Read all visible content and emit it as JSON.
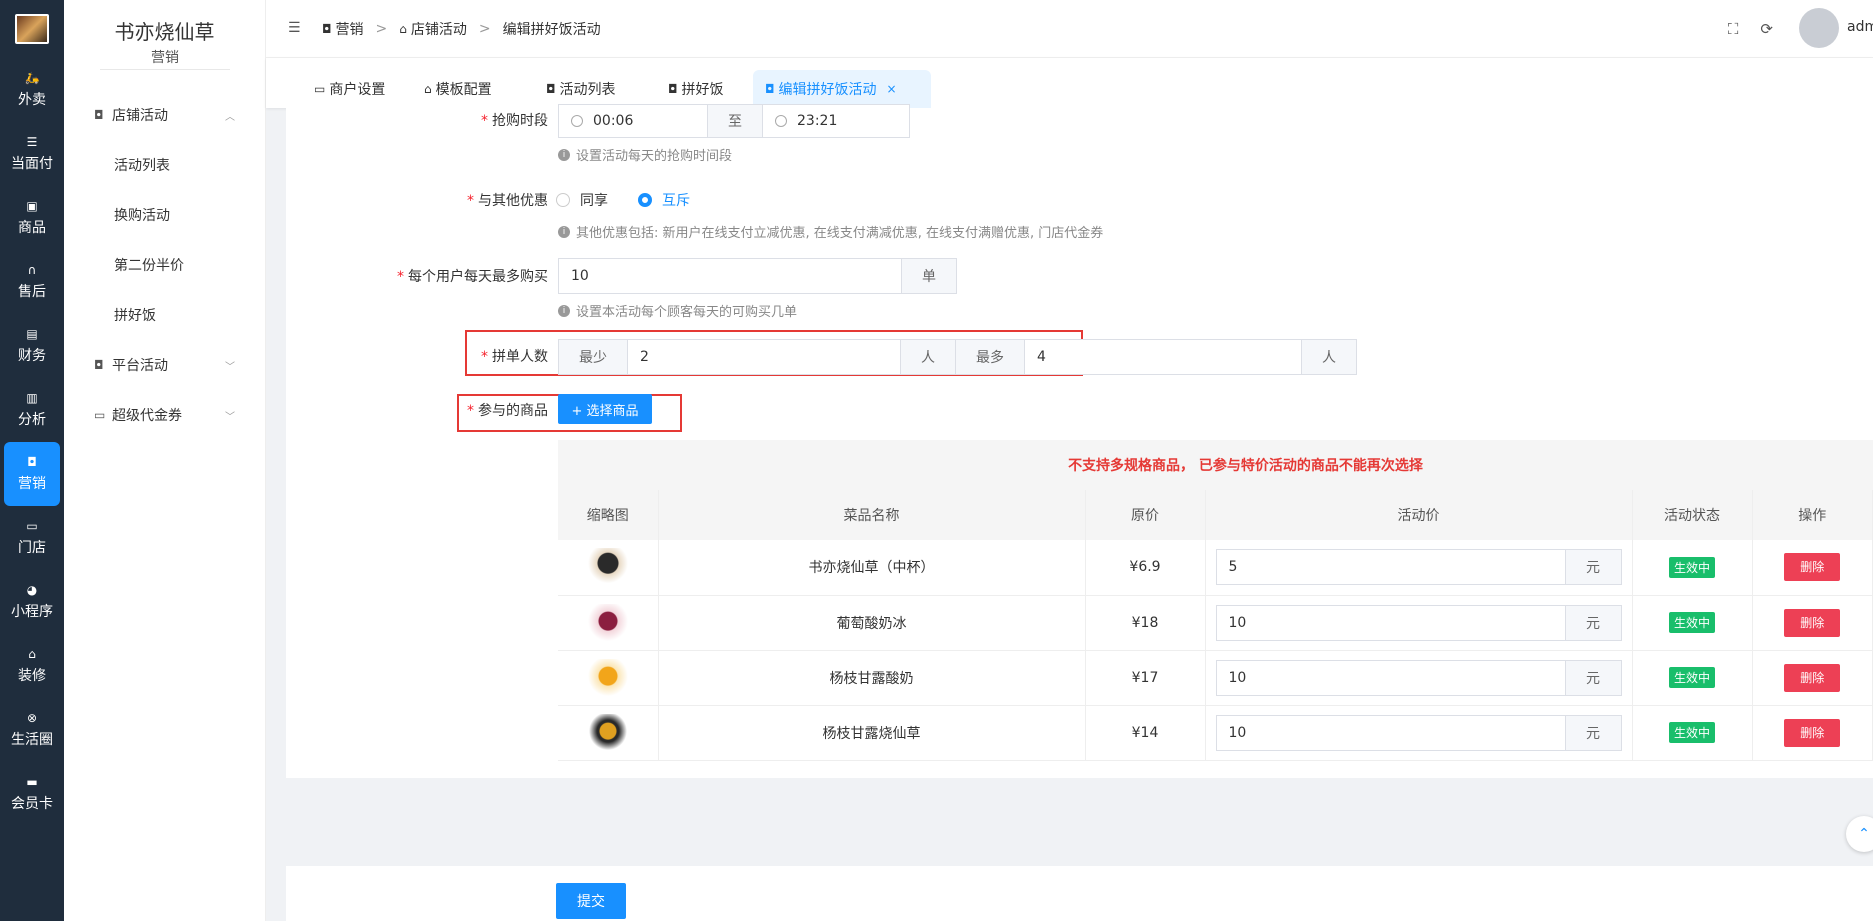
{
  "nav": {
    "items": [
      {
        "label": "外卖",
        "icon": "motorbike-icon"
      },
      {
        "label": "当面付",
        "icon": "list-icon"
      },
      {
        "label": "商品",
        "icon": "bag-icon"
      },
      {
        "label": "售后",
        "icon": "headset-icon"
      },
      {
        "label": "财务",
        "icon": "wallet-icon"
      },
      {
        "label": "分析",
        "icon": "bar-chart-icon"
      },
      {
        "label": "营销",
        "icon": "gift-icon"
      },
      {
        "label": "门店",
        "icon": "sofa-icon"
      },
      {
        "label": "小程序",
        "icon": "wechat-icon"
      },
      {
        "label": "装修",
        "icon": "shop-icon"
      },
      {
        "label": "生活圈",
        "icon": "circle-icon"
      },
      {
        "label": "会员卡",
        "icon": "card-icon"
      }
    ],
    "active": "营销"
  },
  "submenu": {
    "shop_name": "书亦烧仙草",
    "section": "营销",
    "groups": [
      {
        "label": "店铺活动",
        "expanded": true,
        "children": [
          "活动列表",
          "换购活动",
          "第二份半价",
          "拼好饭"
        ]
      },
      {
        "label": "平台活动",
        "expanded": false
      },
      {
        "label": "超级代金券",
        "expanded": false
      }
    ]
  },
  "header": {
    "breadcrumb": [
      "营销",
      "店铺活动",
      "编辑拼好饭活动"
    ],
    "user": "adm"
  },
  "tabs": [
    {
      "label": "商户设置"
    },
    {
      "label": "模板配置"
    },
    {
      "label": "活动列表"
    },
    {
      "label": "拼好饭"
    },
    {
      "label": "编辑拼好饭活动",
      "active": true,
      "close": "×"
    }
  ],
  "form": {
    "time_label": "抢购时段",
    "time_start": "00:06",
    "time_to": "至",
    "time_end": "23:21",
    "time_hint": "设置活动每天的抢购时间段",
    "discount_label": "与其他优惠",
    "discount_options": [
      "同享",
      "互斥"
    ],
    "discount_selected": "互斥",
    "discount_hint": "其他优惠包括: 新用户在线支付立减优惠, 在线支付满减优惠, 在线支付满赠优惠, 门店代金券",
    "limit_label": "每个用户每天最多购买",
    "limit_value": "10",
    "limit_unit": "单",
    "limit_hint": "设置本活动每个顾客每天的可购买几单",
    "group_label": "拼单人数",
    "group_min_label": "最少",
    "group_min": "2",
    "group_min_unit": "人",
    "group_max_label": "最多",
    "group_max": "4",
    "group_max_unit": "人",
    "goods_label": "参与的商品",
    "goods_button": "+ 选择商品"
  },
  "table": {
    "warning": "不支持多规格商品， 已参与特价活动的商品不能再次选择",
    "headers": [
      "缩略图",
      "菜品名称",
      "原价",
      "活动价",
      "活动状态",
      "操作"
    ],
    "rows": [
      {
        "name": "书亦烧仙草（中杯）",
        "price": "¥6.9",
        "sale": "5",
        "unit": "元",
        "status": "生效中",
        "action": "删除"
      },
      {
        "name": "葡萄酸奶冰",
        "price": "¥18",
        "sale": "10",
        "unit": "元",
        "status": "生效中",
        "action": "删除"
      },
      {
        "name": "杨枝甘露酸奶",
        "price": "¥17",
        "sale": "10",
        "unit": "元",
        "status": "生效中",
        "action": "删除"
      },
      {
        "name": "杨枝甘露烧仙草",
        "price": "¥14",
        "sale": "10",
        "unit": "元",
        "status": "生效中",
        "action": "删除"
      }
    ]
  },
  "submit_label": "提交",
  "colors": {
    "primary": "#1890ff",
    "danger": "#ed4055",
    "success": "#19be6b",
    "nav_bg": "#1f2d3d",
    "highlight": "#e53935"
  }
}
